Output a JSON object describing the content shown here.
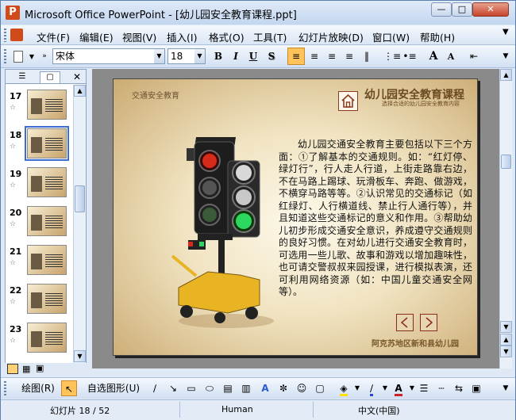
{
  "window": {
    "app_icon_glyph": "P",
    "title": "Microsoft Office PowerPoint - [幼儿园安全教育课程.ppt]"
  },
  "menu": [
    "文件(F)",
    "编辑(E)",
    "视图(V)",
    "插入(I)",
    "格式(O)",
    "工具(T)",
    "幻灯片放映(D)",
    "窗口(W)",
    "帮助(H)"
  ],
  "formatting": {
    "font": "宋体",
    "size": "18",
    "bold": "B",
    "italic": "I",
    "underline": "U",
    "shadow": "S",
    "grow_font": "A",
    "shrink_font": "A"
  },
  "thumbnails": [
    {
      "num": "17"
    },
    {
      "num": "18"
    },
    {
      "num": "19"
    },
    {
      "num": "20"
    },
    {
      "num": "21"
    },
    {
      "num": "22"
    },
    {
      "num": "23"
    }
  ],
  "slide": {
    "header": "交通安全教育",
    "title": "幼儿园安全教育课程",
    "subtitle": "选择合适的幼儿园安全教育内容",
    "body": "幼儿园交通安全教育主要包括以下三个方面：①了解基本的交通规则。如：“红灯停、绿灯行”，行人走人行道，上街走路靠右边，不在马路上踢球、玩滑板车、奔跑、做游戏，不横穿马路等等。②认识常见的交通标记（如红绿灯、人行横道线、禁止行人通行等），并且知道这些交通标记的意义和作用。③帮助幼儿初步形成交通安全意识，养成遵守交通规则的良好习惯。在对幼儿进行交通安全教育时，可选用一些儿歌、故事和游戏以增加趣味性，也可请交警叔叔来园授课，进行模拟表演，还可利用网络资源（如：中国儿童交通安全网等）。",
    "footer": "阿克苏地区新和县幼儿园"
  },
  "draw_toolbar": {
    "draw": "绘图(R)",
    "autoshapes": "自选图形(U)"
  },
  "status": {
    "slide": "幻灯片 18 / 52",
    "design": "Human",
    "language": "中文(中国)"
  },
  "colors": {
    "accent": "#ffc35a",
    "selection": "#3a6ed0",
    "slide_bg": "#f1e4c2"
  }
}
